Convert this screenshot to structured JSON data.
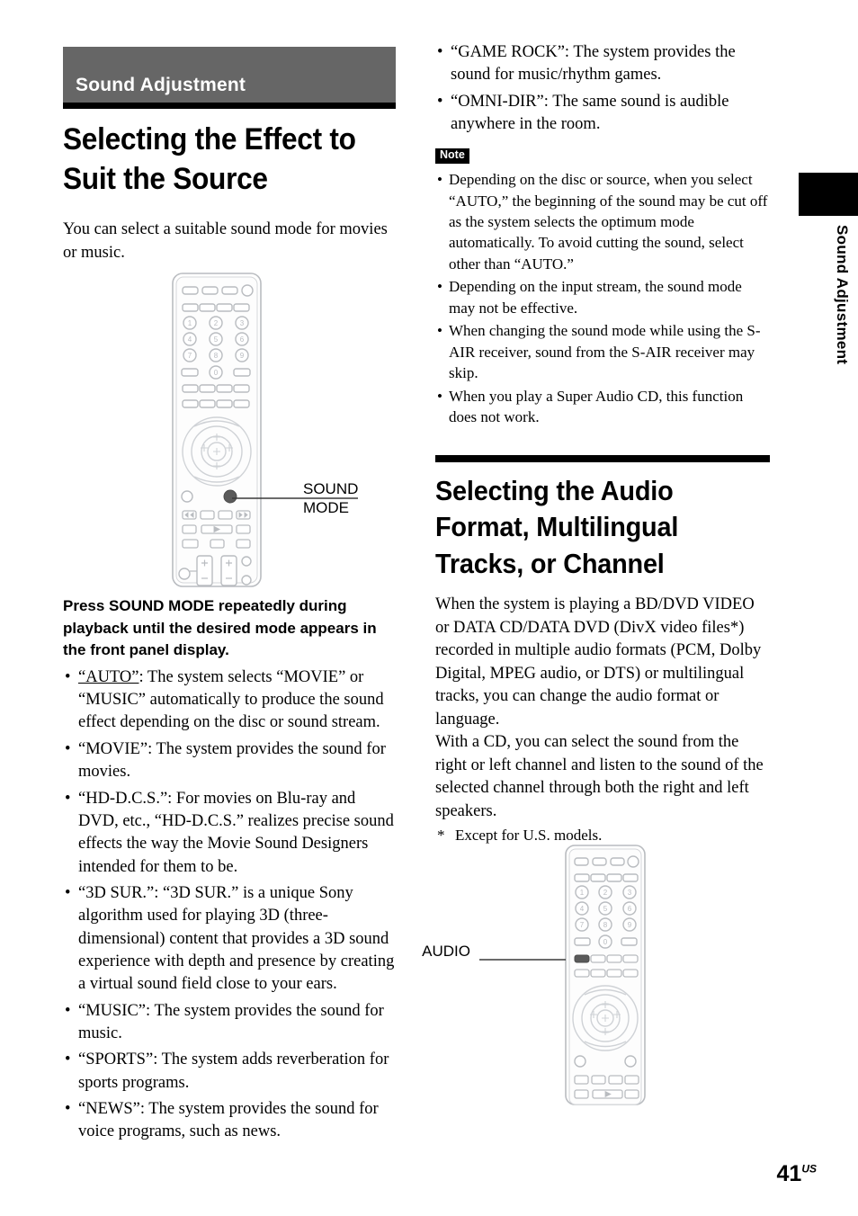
{
  "page": {
    "number": "41",
    "region_suffix": "US",
    "side_tab_label": "Sound Adjustment"
  },
  "left_column": {
    "section_band_label": "Sound Adjustment",
    "chapter_title": "Selecting the Effect to Suit the Source",
    "intro_paragraph": "You can select a suitable sound mode for movies or music.",
    "remote_figure": {
      "name": "remote-control-sound-mode",
      "callout_label": "SOUND\nMODE",
      "highlighted_button": "SOUND MODE"
    },
    "lead_in": "Press SOUND MODE repeatedly during playback until the desired mode appears in the front panel display.",
    "mode_bullets": [
      {
        "term": "“AUTO”",
        "term_underlined": true,
        "text": ": The system selects “MOVIE” or “MUSIC” automatically to produce the sound effect depending on the disc or sound stream."
      },
      {
        "term": "“MOVIE”",
        "term_underlined": false,
        "text": ": The system provides the sound for movies."
      },
      {
        "term": "“HD-D.C.S.”",
        "term_underlined": false,
        "text": ": For movies on Blu-ray and DVD, etc., “HD-D.C.S.” realizes precise sound effects the way the Movie Sound Designers intended for them to be."
      },
      {
        "term": "“3D SUR.”",
        "term_underlined": false,
        "text": ": “3D SUR.” is a unique Sony algorithm used for playing 3D (three-dimensional) content that provides a 3D sound experience with depth and presence by creating a virtual sound field close to your ears."
      },
      {
        "term": "“MUSIC”",
        "term_underlined": false,
        "text": ": The system provides the sound for music."
      },
      {
        "term": "“SPORTS”",
        "term_underlined": false,
        "text": ": The system adds reverberation for sports programs."
      },
      {
        "term": "“NEWS”",
        "term_underlined": false,
        "text": ": The system provides the sound for voice programs, such as news."
      }
    ]
  },
  "right_column": {
    "mode_bullets_continued": [
      "“GAME ROCK”: The system provides the sound for music/rhythm games.",
      "“OMNI-DIR”: The same sound is audible anywhere in the room."
    ],
    "note_badge_label": "Note",
    "note_bullets": [
      "Depending on the disc or source, when you select “AUTO,” the beginning of the sound may be cut off as the system selects the optimum mode automatically. To avoid cutting the sound, select other than “AUTO.”",
      "Depending on the input stream, the sound mode may not be effective.",
      "When changing the sound mode while using the S-AIR receiver, sound from the S-AIR receiver may skip.",
      "When you play a Super Audio CD, this function does not work."
    ],
    "chapter_title": "Selecting the Audio Format, Multilingual Tracks, or Channel",
    "paragraphs": [
      "When the system is playing a BD/DVD VIDEO or DATA CD/DATA DVD (DivX video files*) recorded in multiple audio formats (PCM, Dolby Digital, MPEG audio, or DTS) or multilingual tracks, you can change the audio format or language.",
      "With a CD, you can select the sound from the right or left channel and listen to the sound of the selected channel through both the right and left speakers."
    ],
    "footnote_marker": "*",
    "footnote_text": "Except for U.S. models.",
    "remote_figure": {
      "name": "remote-control-audio",
      "callout_label": "AUDIO",
      "highlighted_button": "AUDIO"
    }
  },
  "keypad_digits": [
    "1",
    "2",
    "3",
    "4",
    "5",
    "6",
    "7",
    "8",
    "9",
    "0"
  ],
  "colors": {
    "band_gray": "#666666",
    "rule_black": "#000000",
    "remote_outline": "#b9bcc0",
    "highlight_button": "#5a5a5a"
  }
}
